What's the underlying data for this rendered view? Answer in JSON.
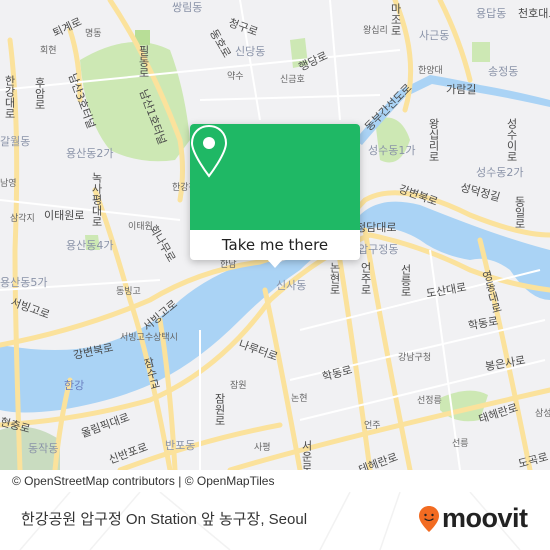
{
  "map": {
    "colors": {
      "land": "#f1f1f3",
      "water": "#aad3f5",
      "park": "#cde8b4",
      "road_major": "#fbe29c",
      "road_minor": "#ffffff"
    },
    "labels": {
      "t1": "퇴계로",
      "t2": "명동",
      "t3": "회현",
      "t4": "쌍림동",
      "t5": "필동로",
      "t6": "청구로",
      "t7": "동호로",
      "t8": "신당동",
      "t9": "행당로",
      "t10": "약수",
      "t11": "신금호",
      "t12": "왕십리",
      "t13": "마조로",
      "t14": "사근동",
      "t15": "용답동",
      "t16": "천호대로",
      "t17": "송정동",
      "t18": "한양대",
      "t19": "가람길",
      "t20": "동부간선도로",
      "t21": "왕십리로",
      "t22": "성수이로",
      "t23": "성수동1가",
      "t24": "성수동2가",
      "t25": "성덕정길",
      "t26": "강변북로",
      "t27": "동일로",
      "t28": "한강대로",
      "t29": "후암로",
      "t30": "남산3호터널",
      "t31": "남산1호터널",
      "t32": "갈월동",
      "t33": "용산동2가",
      "t34": "녹사평대로",
      "t35": "남영",
      "t36": "삼각지",
      "t37": "이태원로",
      "t38": "이태원",
      "t39": "한강진",
      "t40": "용산동4가",
      "t41": "회나무로",
      "t42": "용산동5가",
      "t43": "동빙고",
      "t44": "서빙고로",
      "t45": "서빙고로",
      "t46": "서빙고수상택시",
      "t47": "강변북로",
      "t48": "잠수교",
      "t49": "한강",
      "t50": "현충로",
      "t51": "동작동",
      "t52": "올림픽대로",
      "t53": "신반포로",
      "t54": "반포동",
      "t55": "한남",
      "t56": "신사동",
      "t57": "논현로",
      "t58": "언주로",
      "t59": "선릉로",
      "t60": "도산대로",
      "t61": "영동대로",
      "t62": "학동로",
      "t63": "나루터로",
      "t64": "잠원",
      "t65": "잠원로",
      "t66": "논현",
      "t67": "학동로",
      "t68": "강남구청",
      "t69": "봉은사로",
      "t70": "선정릉",
      "t71": "태헤란로",
      "t72": "삼성",
      "t73": "언주",
      "t74": "선릉",
      "t75": "사평",
      "t76": "서운로",
      "t77": "테헤란로",
      "t78": "도곡로",
      "t79": "청담대로",
      "t80": "압구정동",
      "t81": "언주로"
    }
  },
  "popup": {
    "icon": "map-pin-icon",
    "button_label": "Take me there",
    "accent_color": "#1fb865"
  },
  "attribution": "© OpenStreetMap contributors | © OpenMapTiles",
  "footer": {
    "title": "한강공원 압구정 On Station 앞 농구장, Seoul",
    "brand": "moovit",
    "brand_icon": "moovit-pin-smile-icon",
    "brand_color": "#f26b21"
  }
}
